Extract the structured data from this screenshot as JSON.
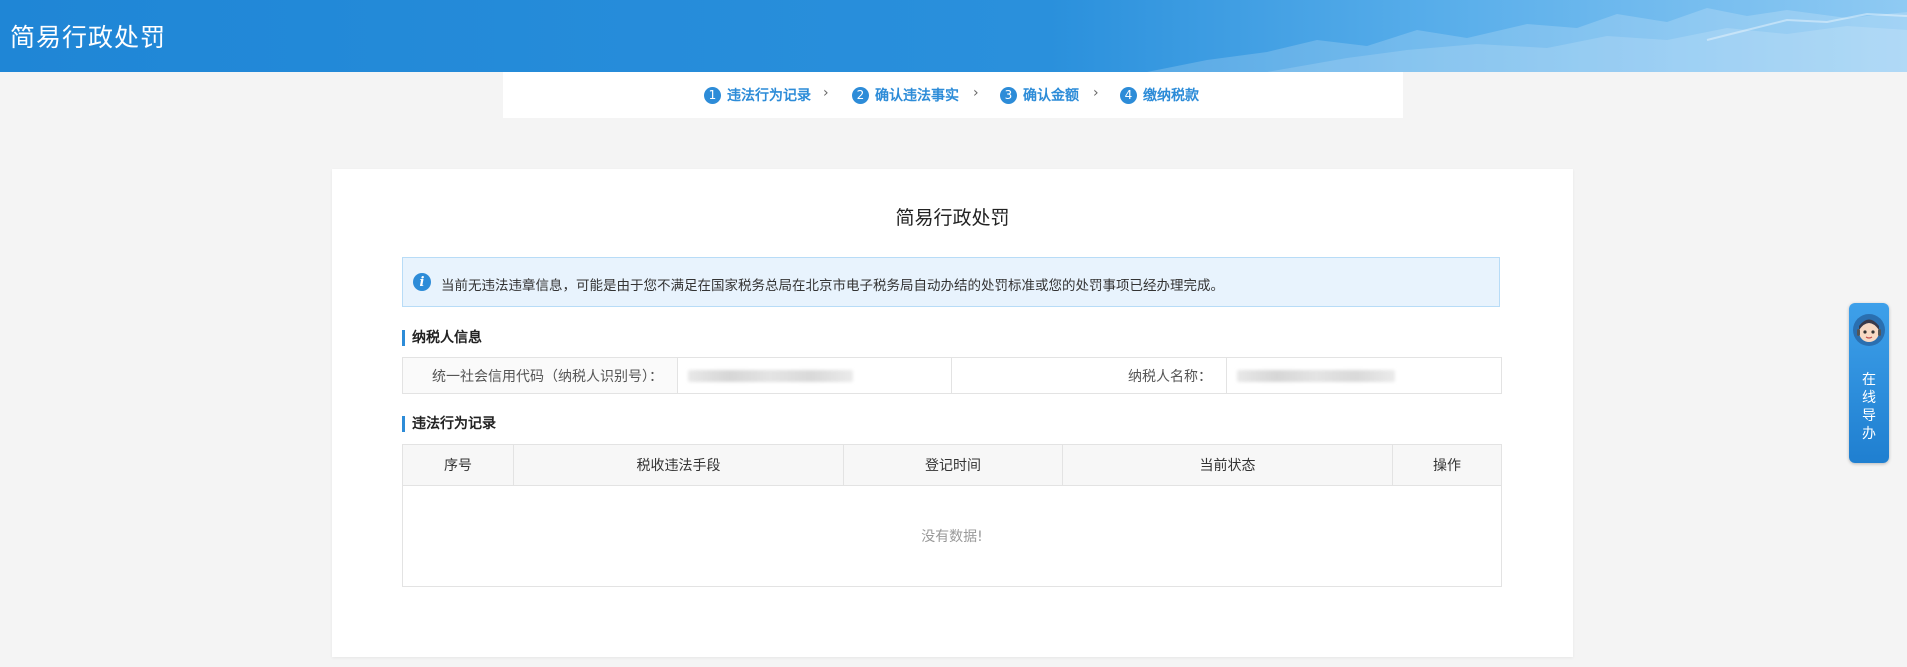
{
  "header": {
    "title": "简易行政处罚"
  },
  "steps": [
    {
      "num": "1",
      "label": "违法行为记录"
    },
    {
      "num": "2",
      "label": "确认违法事实"
    },
    {
      "num": "3",
      "label": "确认金额"
    },
    {
      "num": "4",
      "label": "缴纳税款"
    }
  ],
  "card": {
    "title": "简易行政处罚",
    "notice": "当前无违法违章信息，可能是由于您不满足在国家税务总局在北京市电子税务局自动办结的处罚标准或您的处罚事项已经办理完成。",
    "taxpayer_section": "纳税人信息",
    "credit_code_label": "统一社会信用代码（纳税人识别号）：",
    "taxpayer_name_label": "纳税人名称：",
    "violation_section": "违法行为记录",
    "columns": [
      "序号",
      "税收违法手段",
      "登记时间",
      "当前状态",
      "操作"
    ],
    "empty_text": "没有数据!"
  },
  "side_widget": {
    "chars": [
      "在",
      "线",
      "导",
      "办"
    ]
  },
  "colors": {
    "accent": "#2d8cd8",
    "header": "#1f86d6",
    "notice_bg": "#e8f3fd"
  },
  "icons": {
    "notice": "info-icon",
    "step_separator": "chevron-right-icon",
    "widget": "customer-service-avatar-icon"
  }
}
